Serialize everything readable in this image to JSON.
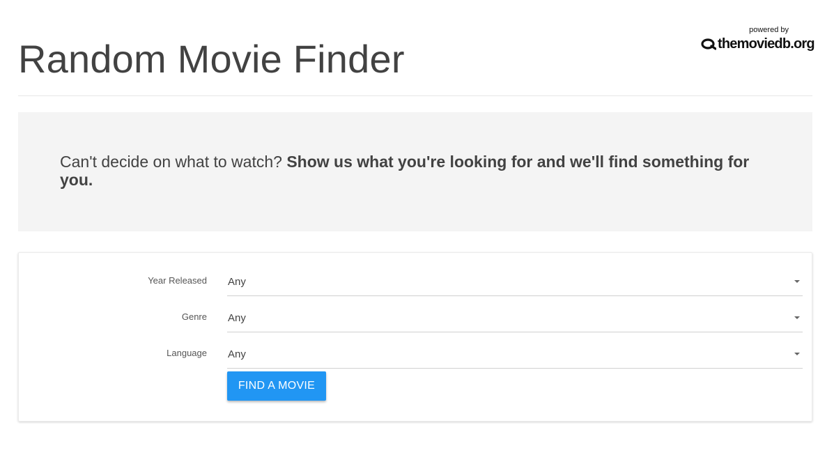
{
  "header": {
    "title": "Random Movie Finder",
    "attribution": {
      "powered_by": "powered by",
      "logo_text": "themoviedb.org"
    }
  },
  "hero": {
    "lead": "Can't decide on what to watch? ",
    "emphasis": "Show us what you're looking for and we'll find something for you."
  },
  "form": {
    "fields": [
      {
        "label": "Year Released",
        "value": "Any"
      },
      {
        "label": "Genre",
        "value": "Any"
      },
      {
        "label": "Language",
        "value": "Any"
      }
    ],
    "submit_label": "FIND A MOVIE"
  },
  "colors": {
    "accent": "#2196f3",
    "hero_background": "#f4f4f4",
    "text": "#424242"
  }
}
